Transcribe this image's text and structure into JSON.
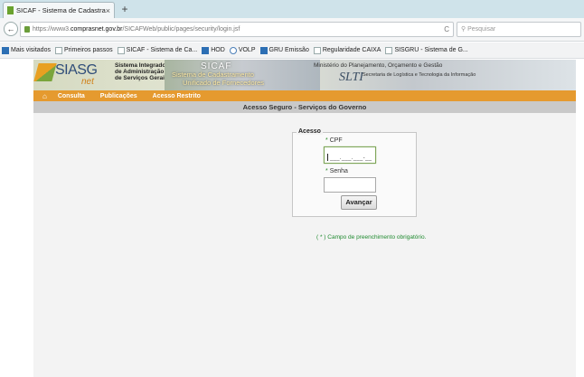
{
  "browser": {
    "tab_title": "SICAF - Sistema de Cadastrame...",
    "tab_close": "×",
    "new_tab": "+",
    "url_prefix": "https://www3.",
    "url_domain": "comprasnet.gov.br",
    "url_path": "/SICAFWeb/public/pages/security/login.jsf",
    "reload": "C",
    "search_placeholder": "Pesquisar",
    "back": "←"
  },
  "bookmarks": [
    {
      "label": "Mais visitados",
      "icon": "folder-icon"
    },
    {
      "label": "Primeiros passos",
      "icon": "page-icon"
    },
    {
      "label": "SICAF - Sistema de Ca...",
      "icon": "page-icon"
    },
    {
      "label": "HOD",
      "icon": "hod-icon"
    },
    {
      "label": "VOLP",
      "icon": "volp-icon"
    },
    {
      "label": "GRU Emissão",
      "icon": "gru-icon"
    },
    {
      "label": "Regularidade CAIXA",
      "icon": "page-icon"
    },
    {
      "label": "SISGRU - Sistema de G...",
      "icon": "page-icon"
    }
  ],
  "header": {
    "logo": "SIASG",
    "logo_net": "net",
    "logo_sub": "Sistema Integrado de Administração de Serviços Gerais",
    "banner_title": "SICAF",
    "banner_line1": "Sistema de Cadastramento",
    "banner_line2": "Unificado de Fornecedores",
    "ministry": "Ministério do Planejamento, Orçamento e Gestão",
    "slti": "SLTI",
    "slti_sub": "Secretaria de Logística e Tecnologia da Informação"
  },
  "nav": {
    "home_icon": "home-icon",
    "items": [
      "Consulta",
      "Publicações",
      "Acesso Restrito"
    ]
  },
  "page_title": "Acesso Seguro - Serviços do Governo",
  "form": {
    "legend": "Acesso",
    "cpf_label": "CPF",
    "cpf_mask": "___.___.___-__",
    "password_label": "Senha",
    "required_marker": "*",
    "submit_label": "Avançar"
  },
  "required_note": "( * ) Campo de preenchimento obrigatório.",
  "colors": {
    "accent_orange": "#e59a2f",
    "required_green": "#1f8a2f",
    "title_bar": "#c9c9c9"
  }
}
